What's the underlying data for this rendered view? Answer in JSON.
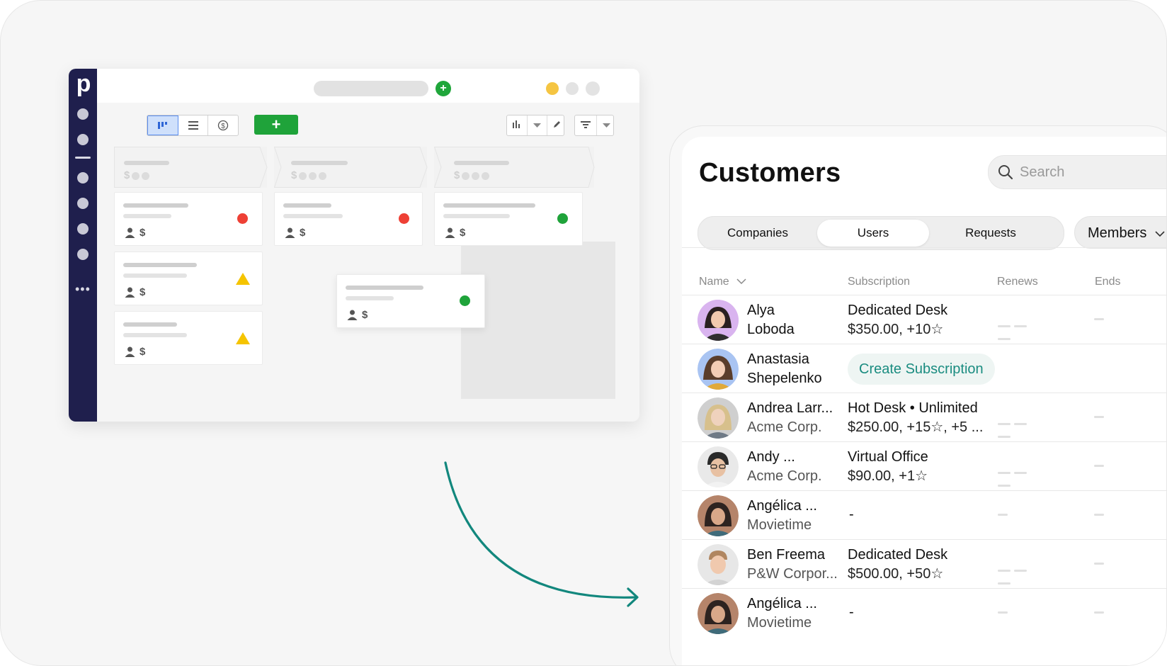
{
  "colors": {
    "pipedrive_rail": "#1f1f4d",
    "green": "#1fa33a",
    "red": "#ee4035",
    "yellow": "#f5c400",
    "teal": "#1a8c80"
  },
  "pipedrive": {
    "logo_letter": "p",
    "add_label": "+",
    "stages": [
      {
        "money": "$"
      },
      {
        "money": "$"
      },
      {
        "money": "$"
      }
    ],
    "card_meta": {
      "person_icon": "person-icon",
      "dollar": "$"
    }
  },
  "customers": {
    "title": "Customers",
    "search": {
      "placeholder": "Search"
    },
    "tabs": [
      "Companies",
      "Users",
      "Requests"
    ],
    "active_tab": "Users",
    "members_label": "Members",
    "columns": {
      "name": "Name",
      "subscription": "Subscription",
      "renews": "Renews",
      "ends": "Ends"
    },
    "rows": [
      {
        "name": "Alya",
        "sub": "Loboda",
        "plan": "Dedicated Desk",
        "plan_sub": "$350.00, +10☆",
        "avatar": "avatar-alya"
      },
      {
        "name": "Anastasia",
        "sub": "Shepelenko",
        "action": "Create Subscription",
        "avatar": "avatar-anastasia"
      },
      {
        "name": "Andrea Larr...",
        "sub": "Acme Corp.",
        "plan": "Hot Desk • Unlimited",
        "plan_sub": "$250.00, +15☆, +5 ...",
        "avatar": "avatar-andrea"
      },
      {
        "name": "Andy ...",
        "sub": "Acme Corp.",
        "plan": "Virtual Office",
        "plan_sub": "$90.00, +1☆",
        "avatar": "avatar-andy"
      },
      {
        "name": "Angélica ...",
        "sub": "Movietime",
        "plan_single": "-",
        "avatar": "avatar-angelica"
      },
      {
        "name": "Ben Freema",
        "sub": "P&W Corpor...",
        "plan": "Dedicated Desk",
        "plan_sub": "$500.00, +50☆",
        "avatar": "avatar-ben"
      },
      {
        "name": "Angélica ...",
        "sub": "Movietime",
        "plan_single": "-",
        "avatar": "avatar-angelica-2"
      }
    ]
  }
}
